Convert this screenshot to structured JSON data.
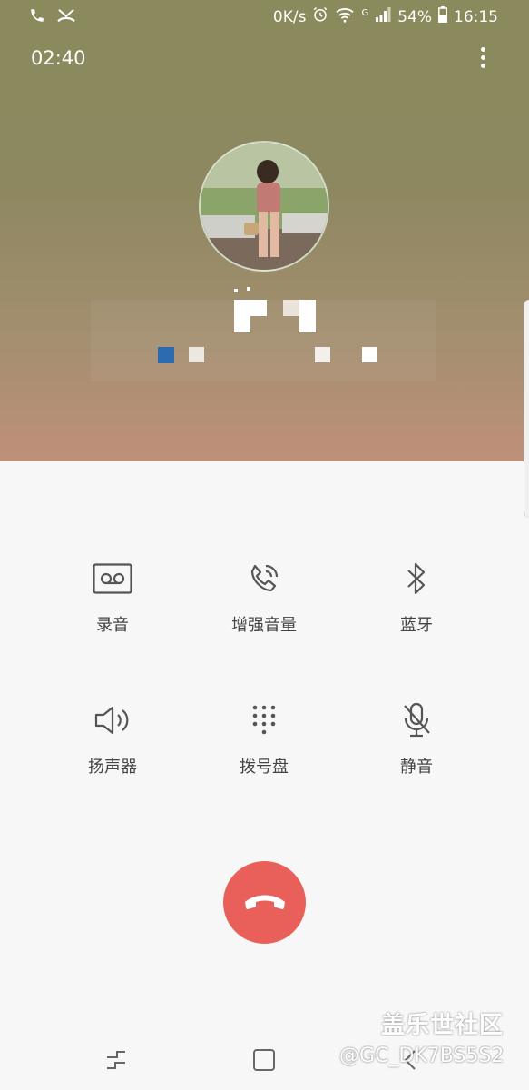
{
  "status_bar": {
    "net_speed": "0K/s",
    "network_type": "G",
    "battery": "54%",
    "time": "16:15"
  },
  "call": {
    "timer": "02:40"
  },
  "actions": [
    {
      "label": "录音",
      "icon": "voicemail-icon"
    },
    {
      "label": "增强音量",
      "icon": "phone-volume-icon"
    },
    {
      "label": "蓝牙",
      "icon": "bluetooth-icon"
    },
    {
      "label": "扬声器",
      "icon": "speaker-icon"
    },
    {
      "label": "拨号盘",
      "icon": "dialpad-icon"
    },
    {
      "label": "静音",
      "icon": "mute-mic-icon"
    }
  ],
  "end_call": {
    "icon": "end-call-icon"
  },
  "watermark": {
    "site": "盖乐世社区",
    "user": "@GC_DK7BS5S2"
  },
  "colors": {
    "header_top": "#8a8a5c",
    "header_bottom": "#bf9079",
    "end_call": "#e9605a",
    "background": "#f7f7f7"
  }
}
